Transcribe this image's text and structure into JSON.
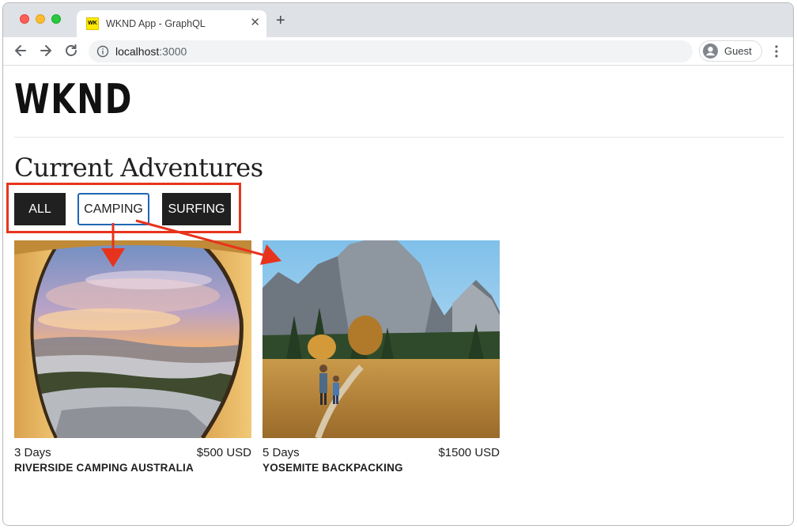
{
  "browser": {
    "tab_title": "WKND App - GraphQL",
    "favicon_text": "WK",
    "new_tab_label": "+",
    "close_label": "✕",
    "url_host": "localhost",
    "url_port": ":3000",
    "profile_label": "Guest"
  },
  "page": {
    "logo": "WKND",
    "heading": "Current Adventures",
    "filters": [
      {
        "label": "ALL",
        "state": "filled"
      },
      {
        "label": "CAMPING",
        "state": "selected"
      },
      {
        "label": "SURFING",
        "state": "filled"
      }
    ],
    "adventures": [
      {
        "days": "3 Days",
        "price": "$500 USD",
        "title": "RIVERSIDE CAMPING AUSTRALIA",
        "image": "tent-view-sunset"
      },
      {
        "days": "5 Days",
        "price": "$1500 USD",
        "title": "YOSEMITE BACKPACKING",
        "image": "yosemite-hikers-meadow"
      }
    ]
  },
  "colors": {
    "annotation": "#e8331c",
    "selected_border": "#1f66b3",
    "button_dark": "#202020"
  }
}
